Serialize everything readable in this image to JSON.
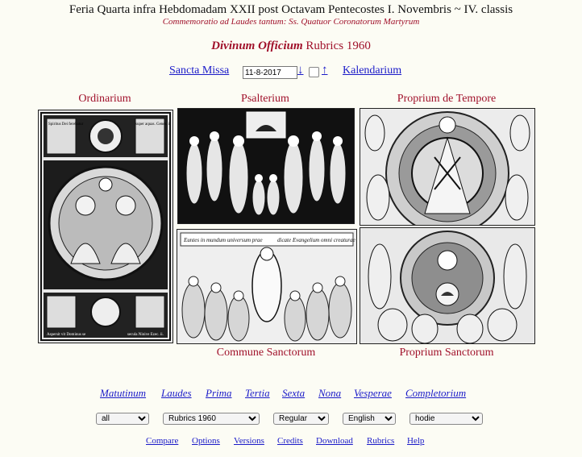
{
  "header": {
    "title": "Feria Quarta infra Hebdomadam XXII post Octavam Pentecostes I. Novembris ~ IV. classis",
    "subtitle": "Commemoratio ad Laudes tantum: Ss. Quatuor Coronatorum Martyrum"
  },
  "office": {
    "name": "Divinum Officium",
    "rubrics": "Rubrics 1960"
  },
  "nav": {
    "sancta_missa": "Sancta Missa",
    "date_value": "11-8-2017",
    "prev_arrow": "↓",
    "next_arrow": "↑",
    "kalendarium": "Kalendarium"
  },
  "sections": {
    "ordinarium": "Ordinarium",
    "psalterium": "Psalterium",
    "proprium_de_tempore": "Proprium de Tempore",
    "commune_sanctorum": "Commune Sanctorum",
    "proprium_sanctorum": "Proprium Sanctorum"
  },
  "engraving_text": {
    "ordinarium_top_left": "Spiritus Dei ferebatur",
    "ordinarium_top_right": "super aquas. Genes. i.",
    "ordinarium_bottom_left": "Aspersit vit Dominus se",
    "ordinarium_bottom_right": "secula Ninive Ezec. ii.",
    "commune_banner_left": "Euntes in mundum universum prae",
    "commune_banner_right": "dicate Evangelium omni creaturae"
  },
  "hours": [
    "Matutinum",
    "Laudes",
    "Prima",
    "Tertia",
    "Sexta",
    "Nona",
    "Vesperae",
    "Completorium"
  ],
  "selects": {
    "scope": "all",
    "rubrics": "Rubrics 1960",
    "mode": "Regular",
    "language": "English",
    "day": "hodie"
  },
  "footer": [
    "Compare",
    "Options",
    "Versions",
    "Credits",
    "Download",
    "Rubrics",
    "Help"
  ],
  "colors": {
    "rubric_red": "#a0102a",
    "link_blue": "#1a1ac8",
    "background": "#fcfcf4"
  }
}
